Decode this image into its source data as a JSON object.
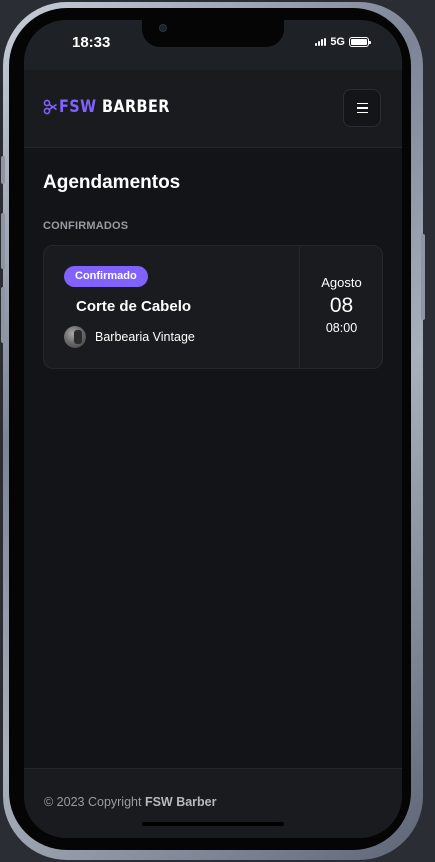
{
  "status_bar": {
    "time": "18:33",
    "network": "5G"
  },
  "header": {
    "logo_accent": "FSW",
    "logo_text": "BARBER",
    "menu_icon": "menu-icon"
  },
  "page": {
    "title": "Agendamentos",
    "section_label": "CONFIRMADOS"
  },
  "bookings": [
    {
      "status": "Confirmado",
      "service": "Corte de Cabelo",
      "shop": "Barbearia Vintage",
      "month": "Agosto",
      "day": "08",
      "time": "08:00"
    }
  ],
  "footer": {
    "copyright_prefix": "© 2023 Copyright",
    "brand": "FSW Barber"
  },
  "colors": {
    "accent": "#8162ff",
    "background": "#131418",
    "card": "#1a1b1f"
  }
}
